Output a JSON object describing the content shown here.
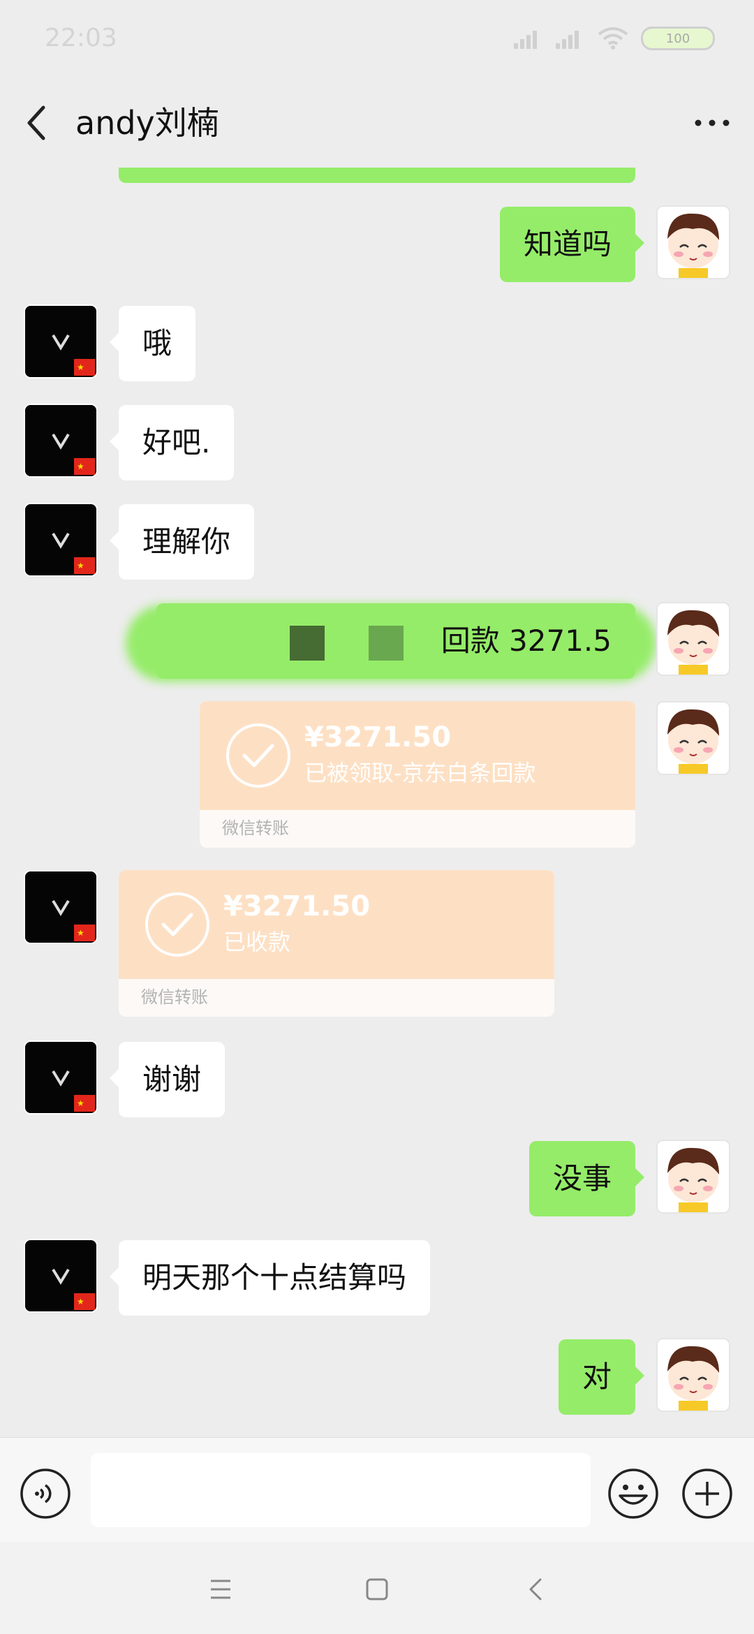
{
  "status_bar": {
    "time": "22:03",
    "battery": "100"
  },
  "header": {
    "title": "andy刘楠"
  },
  "messages": {
    "out_1": "知道吗",
    "in_1": "哦",
    "in_2": "好吧.",
    "in_3": "理解你",
    "out_2": "回款 3271.5",
    "transfer_1": {
      "amount": "¥3271.50",
      "note": "已被领取-京东白条回款",
      "footer": "微信转账"
    },
    "transfer_2": {
      "amount": "¥3271.50",
      "note": "已收款",
      "footer": "微信转账"
    },
    "in_4": "谢谢",
    "out_3": "没事",
    "in_5": "明天那个十点结算吗",
    "out_4": "对"
  },
  "composer": {
    "input_value": ""
  },
  "colors": {
    "sent_bubble": "#95ec69",
    "received_bubble": "#ffffff",
    "transfer_card": "#fde0c4",
    "background": "#ededed"
  }
}
